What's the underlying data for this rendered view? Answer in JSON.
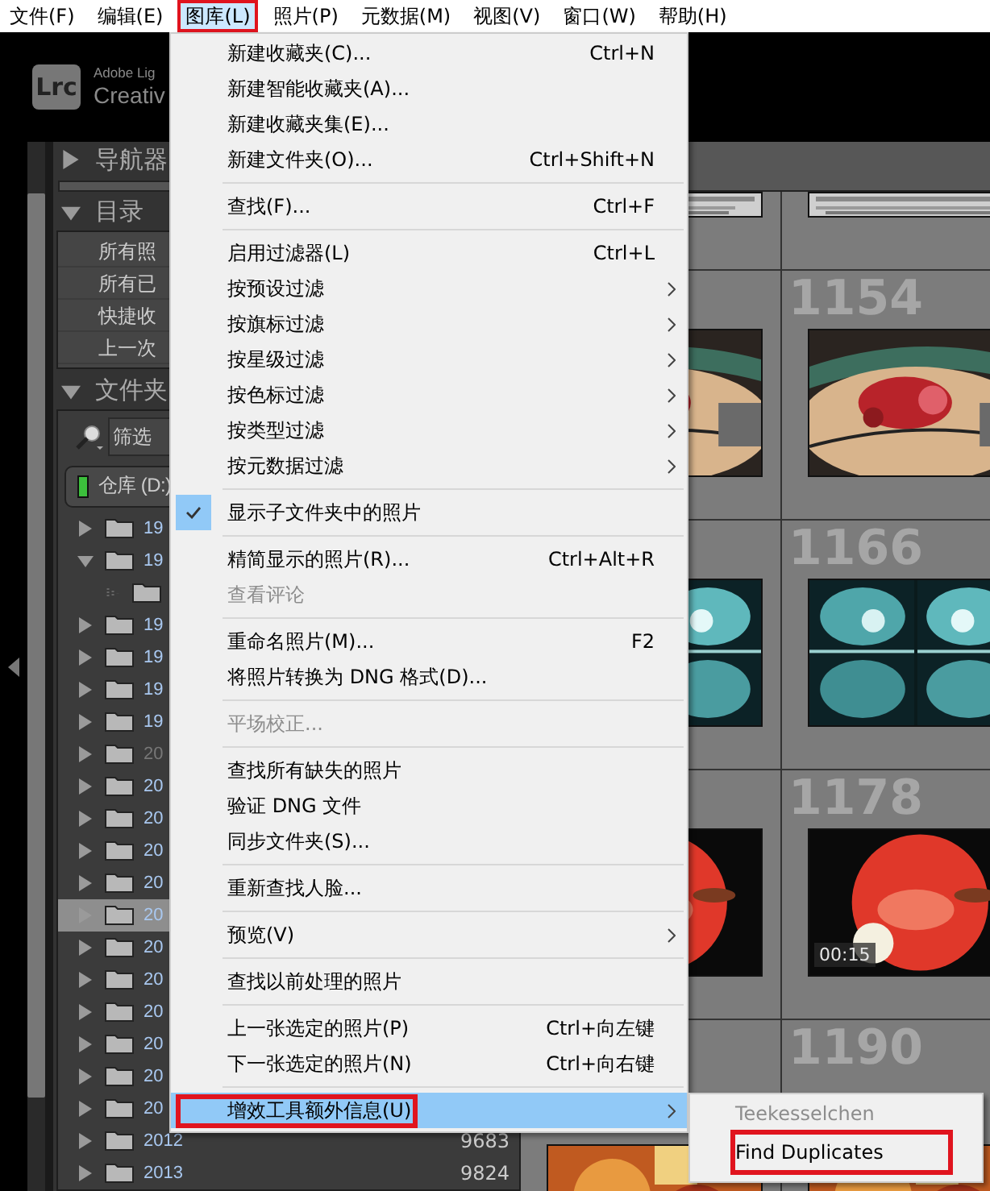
{
  "menubar": [
    {
      "label": "文件(F)",
      "selected": false,
      "annotated": false
    },
    {
      "label": "编辑(E)",
      "selected": false,
      "annotated": false
    },
    {
      "label": "图库(L)",
      "selected": true,
      "annotated": true
    },
    {
      "label": "照片(P)",
      "selected": false,
      "annotated": false
    },
    {
      "label": "元数据(M)",
      "selected": false,
      "annotated": false
    },
    {
      "label": "视图(V)",
      "selected": false,
      "annotated": false
    },
    {
      "label": "窗口(W)",
      "selected": false,
      "annotated": false
    },
    {
      "label": "帮助(H)",
      "selected": false,
      "annotated": false
    }
  ],
  "app_header": {
    "logo": "Lrc",
    "line_1": "Adobe Lig",
    "line_2": "Creativ"
  },
  "left_panel": {
    "navigator": {
      "title": "导航器",
      "expanded": false
    },
    "catalog": {
      "title": "目录",
      "expanded": true,
      "items": [
        "所有照",
        "所有已",
        "快捷收",
        "上一次"
      ]
    },
    "folders": {
      "title": "文件夹",
      "expanded": true,
      "filter": {
        "placeholder": "筛选"
      },
      "volume": {
        "name": "仓库 (D:)",
        "online": true
      },
      "items": [
        {
          "label": "19",
          "expanded": false,
          "selected": false,
          "offline": false
        },
        {
          "label": "19",
          "expanded": true,
          "selected": false,
          "offline": false,
          "children": [
            {
              "selected": false
            }
          ]
        },
        {
          "label": "19",
          "expanded": false,
          "selected": false,
          "offline": false
        },
        {
          "label": "19",
          "expanded": false,
          "selected": false,
          "offline": false
        },
        {
          "label": "19",
          "expanded": false,
          "selected": false,
          "offline": false
        },
        {
          "label": "19",
          "expanded": false,
          "selected": false,
          "offline": false
        },
        {
          "label": "20",
          "expanded": false,
          "selected": false,
          "offline": true
        },
        {
          "label": "20",
          "expanded": false,
          "selected": false,
          "offline": false
        },
        {
          "label": "20",
          "expanded": false,
          "selected": false,
          "offline": false
        },
        {
          "label": "20",
          "expanded": false,
          "selected": false,
          "offline": false
        },
        {
          "label": "20",
          "expanded": false,
          "selected": false,
          "offline": false
        },
        {
          "label": "20",
          "expanded": false,
          "selected": true,
          "offline": false
        },
        {
          "label": "20",
          "expanded": false,
          "selected": false,
          "offline": false
        },
        {
          "label": "20",
          "expanded": false,
          "selected": false,
          "offline": false
        },
        {
          "label": "20",
          "expanded": false,
          "selected": false,
          "offline": false
        },
        {
          "label": "20",
          "expanded": false,
          "selected": false,
          "offline": false
        },
        {
          "label": "20",
          "expanded": false,
          "selected": false,
          "offline": false
        },
        {
          "label": "20",
          "expanded": false,
          "selected": false,
          "offline": false
        },
        {
          "label": "2012",
          "count": "9683",
          "expanded": false,
          "selected": false,
          "offline": false
        },
        {
          "label": "2013",
          "count": "9824",
          "expanded": false,
          "selected": false,
          "offline": false
        }
      ]
    }
  },
  "grid": {
    "rows": [
      {
        "cells": [
          {
            "kind": "picture"
          },
          {
            "kind": "picture"
          }
        ]
      },
      {
        "cells": [
          {
            "kind": "picture"
          },
          {
            "kind": "picture",
            "index": "1154"
          }
        ]
      },
      {
        "cells": [
          {
            "kind": "picture"
          },
          {
            "kind": "picture",
            "index": "1166"
          }
        ]
      },
      {
        "cells": [
          {
            "kind": "picture"
          },
          {
            "kind": "picture",
            "index": "1178",
            "duration": "00:15"
          }
        ]
      },
      {
        "cells": [
          {
            "kind": "picture"
          },
          {
            "kind": "picture",
            "index": "1190"
          }
        ]
      }
    ]
  },
  "library_menu": {
    "items": [
      {
        "kind": "item",
        "label": "新建收藏夹(C)...",
        "shortcut": "Ctrl+N",
        "submenu": false,
        "checked": false,
        "disabled": false,
        "selected": false,
        "annotated": false
      },
      {
        "kind": "item",
        "label": "新建智能收藏夹(A)...",
        "submenu": false,
        "checked": false,
        "disabled": false,
        "selected": false,
        "annotated": false
      },
      {
        "kind": "item",
        "label": "新建收藏夹集(E)...",
        "submenu": false,
        "checked": false,
        "disabled": false,
        "selected": false,
        "annotated": false
      },
      {
        "kind": "item",
        "label": "新建文件夹(O)...",
        "shortcut": "Ctrl+Shift+N",
        "submenu": false,
        "checked": false,
        "disabled": false,
        "selected": false,
        "annotated": false
      },
      {
        "kind": "separator"
      },
      {
        "kind": "item",
        "label": "查找(F)...",
        "shortcut": "Ctrl+F",
        "submenu": false,
        "checked": false,
        "disabled": false,
        "selected": false,
        "annotated": false
      },
      {
        "kind": "separator"
      },
      {
        "kind": "item",
        "label": "启用过滤器(L)",
        "shortcut": "Ctrl+L",
        "submenu": false,
        "checked": false,
        "disabled": false,
        "selected": false,
        "annotated": false
      },
      {
        "kind": "item",
        "label": "按预设过滤",
        "submenu": true,
        "checked": false,
        "disabled": false,
        "selected": false,
        "annotated": false
      },
      {
        "kind": "item",
        "label": "按旗标过滤",
        "submenu": true,
        "checked": false,
        "disabled": false,
        "selected": false,
        "annotated": false
      },
      {
        "kind": "item",
        "label": "按星级过滤",
        "submenu": true,
        "checked": false,
        "disabled": false,
        "selected": false,
        "annotated": false
      },
      {
        "kind": "item",
        "label": "按色标过滤",
        "submenu": true,
        "checked": false,
        "disabled": false,
        "selected": false,
        "annotated": false
      },
      {
        "kind": "item",
        "label": "按类型过滤",
        "submenu": true,
        "checked": false,
        "disabled": false,
        "selected": false,
        "annotated": false
      },
      {
        "kind": "item",
        "label": "按元数据过滤",
        "submenu": true,
        "checked": false,
        "disabled": false,
        "selected": false,
        "annotated": false
      },
      {
        "kind": "separator"
      },
      {
        "kind": "item",
        "label": "显示子文件夹中的照片",
        "submenu": false,
        "checked": true,
        "disabled": false,
        "selected": false,
        "annotated": false
      },
      {
        "kind": "separator"
      },
      {
        "kind": "item",
        "label": "精简显示的照片(R)...",
        "shortcut": "Ctrl+Alt+R",
        "submenu": false,
        "checked": false,
        "disabled": false,
        "selected": false,
        "annotated": false
      },
      {
        "kind": "item",
        "label": "查看评论",
        "submenu": false,
        "checked": false,
        "disabled": true,
        "selected": false,
        "annotated": false
      },
      {
        "kind": "separator"
      },
      {
        "kind": "item",
        "label": "重命名照片(M)...",
        "shortcut": "F2",
        "submenu": false,
        "checked": false,
        "disabled": false,
        "selected": false,
        "annotated": false
      },
      {
        "kind": "item",
        "label": "将照片转换为 DNG 格式(D)...",
        "submenu": false,
        "checked": false,
        "disabled": false,
        "selected": false,
        "annotated": false
      },
      {
        "kind": "separator"
      },
      {
        "kind": "item",
        "label": "平场校正...",
        "submenu": false,
        "checked": false,
        "disabled": true,
        "selected": false,
        "annotated": false
      },
      {
        "kind": "separator"
      },
      {
        "kind": "item",
        "label": "查找所有缺失的照片",
        "submenu": false,
        "checked": false,
        "disabled": false,
        "selected": false,
        "annotated": false
      },
      {
        "kind": "item",
        "label": "验证 DNG 文件",
        "submenu": false,
        "checked": false,
        "disabled": false,
        "selected": false,
        "annotated": false
      },
      {
        "kind": "item",
        "label": "同步文件夹(S)...",
        "submenu": false,
        "checked": false,
        "disabled": false,
        "selected": false,
        "annotated": false
      },
      {
        "kind": "separator"
      },
      {
        "kind": "item",
        "label": "重新查找人脸...",
        "submenu": false,
        "checked": false,
        "disabled": false,
        "selected": false,
        "annotated": false
      },
      {
        "kind": "separator"
      },
      {
        "kind": "item",
        "label": "预览(V)",
        "submenu": true,
        "checked": false,
        "disabled": false,
        "selected": false,
        "annotated": false
      },
      {
        "kind": "separator"
      },
      {
        "kind": "item",
        "label": "查找以前处理的照片",
        "submenu": false,
        "checked": false,
        "disabled": false,
        "selected": false,
        "annotated": false
      },
      {
        "kind": "separator"
      },
      {
        "kind": "item",
        "label": "上一张选定的照片(P)",
        "shortcut": "Ctrl+向左键",
        "submenu": false,
        "checked": false,
        "disabled": false,
        "selected": false,
        "annotated": false
      },
      {
        "kind": "item",
        "label": "下一张选定的照片(N)",
        "shortcut": "Ctrl+向右键",
        "submenu": false,
        "checked": false,
        "disabled": false,
        "selected": false,
        "annotated": false
      },
      {
        "kind": "separator"
      },
      {
        "kind": "item",
        "label": "增效工具额外信息(U)",
        "submenu": true,
        "checked": false,
        "disabled": false,
        "selected": true,
        "annotated": true
      }
    ]
  },
  "submenu": {
    "items": [
      {
        "label": "Teekesselchen",
        "disabled": true,
        "annotated": false
      },
      {
        "label": "Find Duplicates",
        "disabled": false,
        "annotated": true
      }
    ]
  }
}
